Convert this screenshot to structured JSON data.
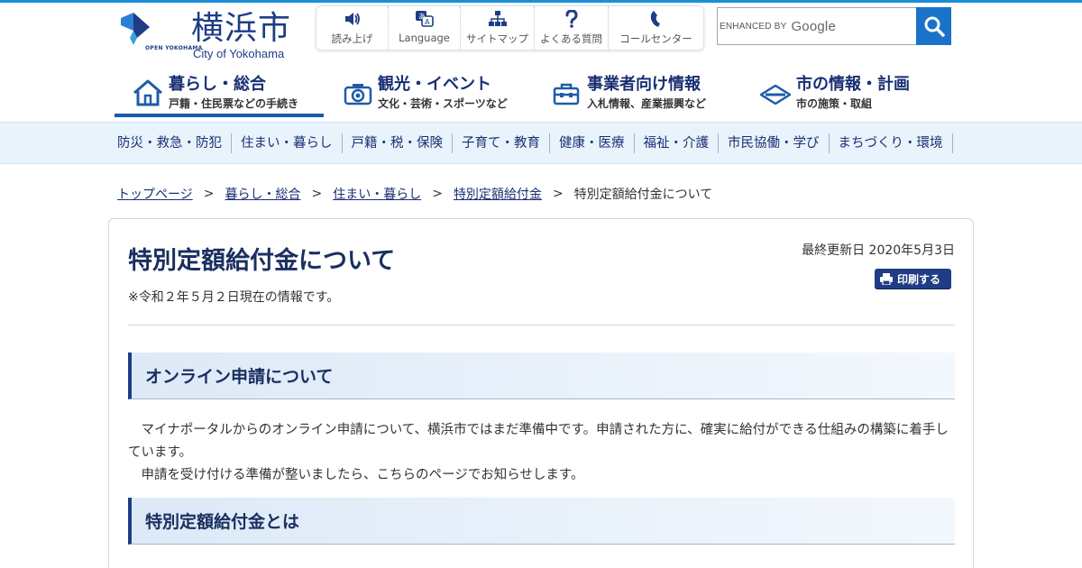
{
  "header": {
    "logo_kanji": "横浜市",
    "logo_en": "City of Yokohama",
    "logo_badge": "OPEN YOKOHAMA"
  },
  "utility": [
    {
      "label": "読み上げ",
      "icon": "speaker-icon"
    },
    {
      "label": "Language",
      "icon": "language-icon"
    },
    {
      "label": "サイトマップ",
      "icon": "sitemap-icon"
    },
    {
      "label": "よくある質問",
      "icon": "question-icon"
    },
    {
      "label": "コールセンター",
      "icon": "phone-icon"
    }
  ],
  "search": {
    "enhanced_by": "ENHANCED BY",
    "google": "Google",
    "icon": "search-icon"
  },
  "main_nav": [
    {
      "title": "暮らし・総合",
      "sub": "戸籍・住民票などの手続き",
      "icon": "house-icon",
      "active": true
    },
    {
      "title": "観光・イベント",
      "sub": "文化・芸術・スポーツなど",
      "icon": "camera-icon",
      "active": false
    },
    {
      "title": "事業者向け情報",
      "sub": "入札情報、産業振興など",
      "icon": "toolbox-icon",
      "active": false
    },
    {
      "title": "市の情報・計画",
      "sub": "市の施策・取組",
      "icon": "diamond-icon",
      "active": false
    }
  ],
  "sub_nav": [
    "防災・救急・防犯",
    "住まい・暮らし",
    "戸籍・税・保険",
    "子育て・教育",
    "健康・医療",
    "福祉・介護",
    "市民協働・学び",
    "まちづくり・環境"
  ],
  "breadcrumb": {
    "links": [
      "トップページ",
      "暮らし・総合",
      "住まい・暮らし",
      "特別定額給付金"
    ],
    "current": "特別定額給付金について",
    "separator": ">"
  },
  "article": {
    "title": "特別定額給付金について",
    "note": "※令和２年５月２日現在の情報です。",
    "updated": "最終更新日 2020年5月3日",
    "print_label": "印刷する",
    "section1_title": "オンライン申請について",
    "para1": "マイナポータルからのオンライン申請について、横浜市ではまだ準備中です。申請された方に、確実に給付ができる仕組みの構築に着手しています。",
    "para2": "申請を受け付ける準備が整いましたら、こちらのページでお知らせします。",
    "section2_title": "特別定額給付金とは"
  },
  "colors": {
    "brand_navy": "#1f3c85",
    "accent_blue": "#1a73c8",
    "subnav_bg": "#e9f3fb"
  }
}
